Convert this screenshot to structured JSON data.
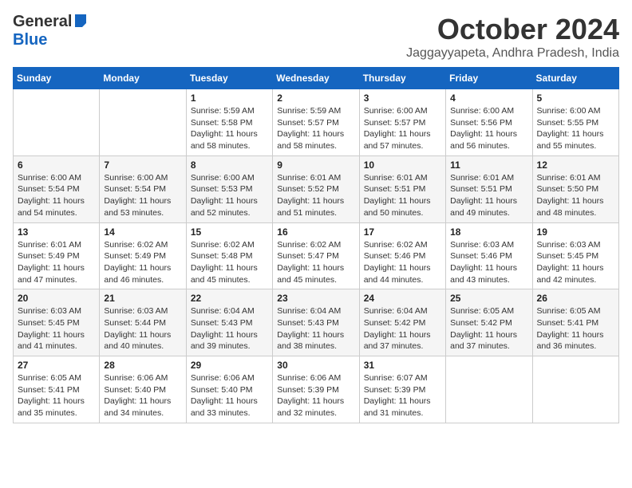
{
  "header": {
    "logo_general": "General",
    "logo_blue": "Blue",
    "month_title": "October 2024",
    "location": "Jaggayyapeta, Andhra Pradesh, India"
  },
  "weekdays": [
    "Sunday",
    "Monday",
    "Tuesday",
    "Wednesday",
    "Thursday",
    "Friday",
    "Saturday"
  ],
  "weeks": [
    [
      {
        "day": "",
        "info": ""
      },
      {
        "day": "",
        "info": ""
      },
      {
        "day": "1",
        "info": "Sunrise: 5:59 AM\nSunset: 5:58 PM\nDaylight: 11 hours and 58 minutes."
      },
      {
        "day": "2",
        "info": "Sunrise: 5:59 AM\nSunset: 5:57 PM\nDaylight: 11 hours and 58 minutes."
      },
      {
        "day": "3",
        "info": "Sunrise: 6:00 AM\nSunset: 5:57 PM\nDaylight: 11 hours and 57 minutes."
      },
      {
        "day": "4",
        "info": "Sunrise: 6:00 AM\nSunset: 5:56 PM\nDaylight: 11 hours and 56 minutes."
      },
      {
        "day": "5",
        "info": "Sunrise: 6:00 AM\nSunset: 5:55 PM\nDaylight: 11 hours and 55 minutes."
      }
    ],
    [
      {
        "day": "6",
        "info": "Sunrise: 6:00 AM\nSunset: 5:54 PM\nDaylight: 11 hours and 54 minutes."
      },
      {
        "day": "7",
        "info": "Sunrise: 6:00 AM\nSunset: 5:54 PM\nDaylight: 11 hours and 53 minutes."
      },
      {
        "day": "8",
        "info": "Sunrise: 6:00 AM\nSunset: 5:53 PM\nDaylight: 11 hours and 52 minutes."
      },
      {
        "day": "9",
        "info": "Sunrise: 6:01 AM\nSunset: 5:52 PM\nDaylight: 11 hours and 51 minutes."
      },
      {
        "day": "10",
        "info": "Sunrise: 6:01 AM\nSunset: 5:51 PM\nDaylight: 11 hours and 50 minutes."
      },
      {
        "day": "11",
        "info": "Sunrise: 6:01 AM\nSunset: 5:51 PM\nDaylight: 11 hours and 49 minutes."
      },
      {
        "day": "12",
        "info": "Sunrise: 6:01 AM\nSunset: 5:50 PM\nDaylight: 11 hours and 48 minutes."
      }
    ],
    [
      {
        "day": "13",
        "info": "Sunrise: 6:01 AM\nSunset: 5:49 PM\nDaylight: 11 hours and 47 minutes."
      },
      {
        "day": "14",
        "info": "Sunrise: 6:02 AM\nSunset: 5:49 PM\nDaylight: 11 hours and 46 minutes."
      },
      {
        "day": "15",
        "info": "Sunrise: 6:02 AM\nSunset: 5:48 PM\nDaylight: 11 hours and 45 minutes."
      },
      {
        "day": "16",
        "info": "Sunrise: 6:02 AM\nSunset: 5:47 PM\nDaylight: 11 hours and 45 minutes."
      },
      {
        "day": "17",
        "info": "Sunrise: 6:02 AM\nSunset: 5:46 PM\nDaylight: 11 hours and 44 minutes."
      },
      {
        "day": "18",
        "info": "Sunrise: 6:03 AM\nSunset: 5:46 PM\nDaylight: 11 hours and 43 minutes."
      },
      {
        "day": "19",
        "info": "Sunrise: 6:03 AM\nSunset: 5:45 PM\nDaylight: 11 hours and 42 minutes."
      }
    ],
    [
      {
        "day": "20",
        "info": "Sunrise: 6:03 AM\nSunset: 5:45 PM\nDaylight: 11 hours and 41 minutes."
      },
      {
        "day": "21",
        "info": "Sunrise: 6:03 AM\nSunset: 5:44 PM\nDaylight: 11 hours and 40 minutes."
      },
      {
        "day": "22",
        "info": "Sunrise: 6:04 AM\nSunset: 5:43 PM\nDaylight: 11 hours and 39 minutes."
      },
      {
        "day": "23",
        "info": "Sunrise: 6:04 AM\nSunset: 5:43 PM\nDaylight: 11 hours and 38 minutes."
      },
      {
        "day": "24",
        "info": "Sunrise: 6:04 AM\nSunset: 5:42 PM\nDaylight: 11 hours and 37 minutes."
      },
      {
        "day": "25",
        "info": "Sunrise: 6:05 AM\nSunset: 5:42 PM\nDaylight: 11 hours and 37 minutes."
      },
      {
        "day": "26",
        "info": "Sunrise: 6:05 AM\nSunset: 5:41 PM\nDaylight: 11 hours and 36 minutes."
      }
    ],
    [
      {
        "day": "27",
        "info": "Sunrise: 6:05 AM\nSunset: 5:41 PM\nDaylight: 11 hours and 35 minutes."
      },
      {
        "day": "28",
        "info": "Sunrise: 6:06 AM\nSunset: 5:40 PM\nDaylight: 11 hours and 34 minutes."
      },
      {
        "day": "29",
        "info": "Sunrise: 6:06 AM\nSunset: 5:40 PM\nDaylight: 11 hours and 33 minutes."
      },
      {
        "day": "30",
        "info": "Sunrise: 6:06 AM\nSunset: 5:39 PM\nDaylight: 11 hours and 32 minutes."
      },
      {
        "day": "31",
        "info": "Sunrise: 6:07 AM\nSunset: 5:39 PM\nDaylight: 11 hours and 31 minutes."
      },
      {
        "day": "",
        "info": ""
      },
      {
        "day": "",
        "info": ""
      }
    ]
  ]
}
